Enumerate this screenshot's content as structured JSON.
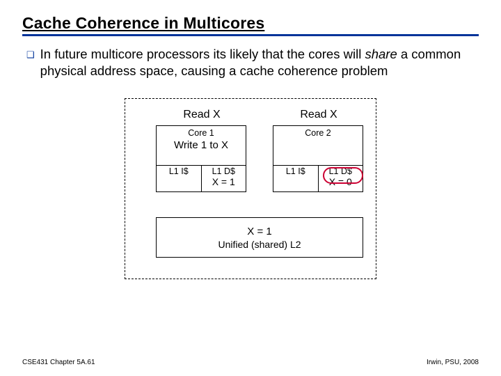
{
  "title": "Cache Coherence in Multicores",
  "bullet": {
    "marker": "❑",
    "pre": "In future multicore processors its likely that the cores will ",
    "em": "share",
    "post": " a common physical address space, causing a cache coherence problem"
  },
  "diagram": {
    "read_left": "Read X",
    "read_right": "Read X",
    "core1": {
      "label": "Core 1",
      "action": "Write 1 to X",
      "l1i": "L1 I$",
      "l1d": "L1 D$",
      "l1d_val": "X = 1"
    },
    "core2": {
      "label": "Core 2",
      "action": "",
      "l1i": "L1 I$",
      "l1d": "L1 D$",
      "l1d_val": "X = 0"
    },
    "l2": {
      "val": "X = 1",
      "label": "Unified (shared) L2"
    }
  },
  "footer": {
    "left": "CSE431 Chapter 5A.61",
    "right": "Irwin, PSU, 2008"
  }
}
